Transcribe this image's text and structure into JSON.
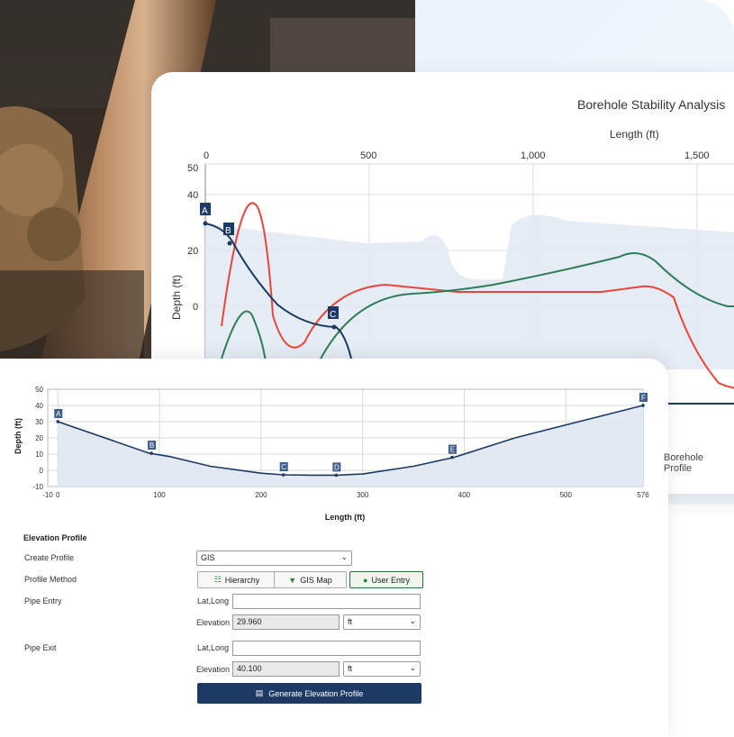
{
  "back_chart": {
    "title": "Borehole Stability Analysis",
    "xlabel": "Length (ft)",
    "ylabel": "Depth (ft)",
    "x_ticks": [
      "0",
      "500",
      "1,000",
      "1,500"
    ],
    "y_ticks": [
      "50",
      "40",
      "20",
      "0"
    ],
    "markers": [
      "A",
      "B",
      "C"
    ],
    "side_label": "Borehole Profile"
  },
  "chart_data": {
    "type": "line",
    "title": "",
    "xlabel": "Length (ft)",
    "ylabel": "Depth (ft)",
    "xlim": [
      -10,
      576
    ],
    "ylim": [
      -10,
      50
    ],
    "x_ticks": [
      "-10",
      "0",
      "100",
      "200",
      "300",
      "400",
      "500",
      "576"
    ],
    "y_ticks": [
      "50",
      "40",
      "30",
      "20",
      "10",
      "0",
      "-10"
    ],
    "series": [
      {
        "x": [
          0,
          90,
          110,
          150,
          200,
          222,
          250,
          275,
          300,
          350,
          390,
          450,
          500,
          576
        ],
        "y": [
          30,
          10.5,
          8.5,
          2.5,
          -1.8,
          -2.8,
          -3,
          -3,
          -2.3,
          2.5,
          8,
          20,
          28,
          40
        ]
      }
    ],
    "markers": [
      {
        "label": "A",
        "x": 0,
        "y": 30
      },
      {
        "label": "B",
        "x": 92,
        "y": 10.5
      },
      {
        "label": "C",
        "x": 222,
        "y": -2.8
      },
      {
        "label": "D",
        "x": 274,
        "y": -3
      },
      {
        "label": "E",
        "x": 388,
        "y": 8
      },
      {
        "label": "F",
        "x": 576,
        "y": 40
      }
    ]
  },
  "form": {
    "title": "Elevation Profile",
    "create_profile_label": "Create Profile",
    "create_profile_value": "GIS",
    "profile_method_label": "Profile Method",
    "methods": [
      "Hierarchy",
      "GIS Map",
      "User Entry"
    ],
    "pipe_entry_label": "Pipe Entry",
    "pipe_exit_label": "Pipe Exit",
    "latlong_label": "Lat,Long",
    "elevation_label": "Elevation",
    "entry_elevation": "29.960",
    "exit_elevation": "40.100",
    "unit": "ft",
    "generate_label": "Generate Elevation Profile"
  },
  "colors": {
    "navy": "#1c3a63",
    "red": "#e8453c",
    "green": "#2e7d5a",
    "fill": "#dfe7f1"
  }
}
